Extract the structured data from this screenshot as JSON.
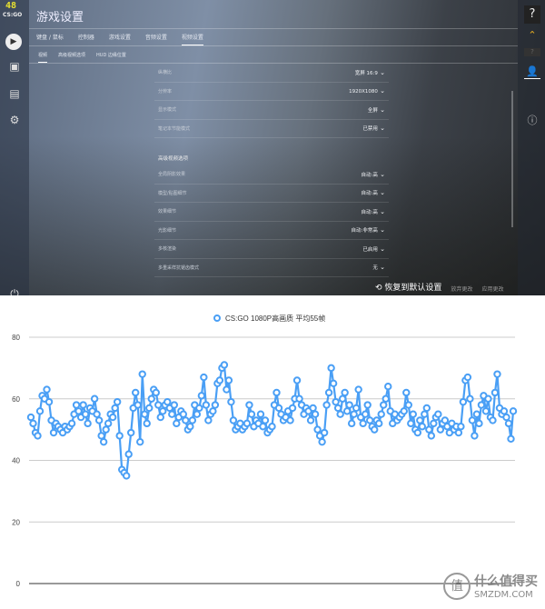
{
  "hud": {
    "fps": "48",
    "logo": "CS:GO"
  },
  "header": {
    "title": "游戏设置"
  },
  "tabs": [
    {
      "label": "键盘 / 鼠标"
    },
    {
      "label": "控制器"
    },
    {
      "label": "游戏设置"
    },
    {
      "label": "音频设置"
    },
    {
      "label": "视频设置"
    }
  ],
  "subtabs": [
    {
      "label": "视频"
    },
    {
      "label": "高级视频选项"
    },
    {
      "label": "HUD 边缘位置"
    }
  ],
  "settings": [
    {
      "label": "纵横比",
      "value": "宽屏 16:9"
    },
    {
      "label": "分辨率",
      "value": "1920X1080"
    },
    {
      "label": "显示模式",
      "value": "全屏"
    },
    {
      "label": "笔记本节能模式",
      "value": "已禁用"
    }
  ],
  "advanced": {
    "title": "高级视频选项",
    "items": [
      {
        "label": "全局阴影效果",
        "value": "自动:高"
      },
      {
        "label": "模型/贴图细节",
        "value": "自动:高"
      },
      {
        "label": "效果细节",
        "value": "自动:高"
      },
      {
        "label": "光影细节",
        "value": "自动:非常高"
      },
      {
        "label": "多核渲染",
        "value": "已启用"
      },
      {
        "label": "多重采样抗锯齿模式",
        "value": "无"
      }
    ]
  },
  "footer": {
    "reset": "恢复到默认设置",
    "discard": "放弃更改",
    "apply": "应用更改"
  },
  "watermark": {
    "brand": "什么值得买",
    "site": "SMZDM.COM",
    "mark": "值"
  },
  "chart_data": {
    "type": "line",
    "title": "",
    "legend": [
      "CS:GO 1080P高画质 平均55帧"
    ],
    "legend_position": "top",
    "ylim": [
      0,
      80
    ],
    "yticks": [
      0,
      20,
      40,
      60,
      80
    ],
    "grid": true,
    "color": "#4a9ff5",
    "series": [
      {
        "name": "CS:GO 1080P高画质 平均55帧",
        "values": [
          54,
          52,
          49,
          48,
          56,
          61,
          60,
          63,
          59,
          53,
          49,
          52,
          51,
          50,
          49,
          51,
          50,
          51,
          52,
          55,
          58,
          56,
          54,
          58,
          55,
          52,
          57,
          56,
          60,
          55,
          53,
          48,
          46,
          50,
          52,
          55,
          54,
          57,
          59,
          48,
          37,
          36,
          35,
          42,
          49,
          57,
          62,
          58,
          46,
          68,
          55,
          52,
          57,
          60,
          63,
          62,
          58,
          54,
          56,
          58,
          59,
          57,
          55,
          58,
          52,
          54,
          56,
          55,
          53,
          50,
          51,
          53,
          58,
          55,
          57,
          61,
          67,
          58,
          53,
          55,
          56,
          58,
          65,
          66,
          70,
          71,
          63,
          66,
          59,
          53,
          50,
          51,
          52,
          50,
          51,
          52,
          58,
          55,
          51,
          53,
          52,
          55,
          51,
          53,
          49,
          50,
          51,
          58,
          62,
          57,
          55,
          53,
          54,
          56,
          53,
          57,
          60,
          66,
          60,
          58,
          55,
          57,
          56,
          53,
          57,
          55,
          50,
          48,
          46,
          49,
          58,
          62,
          70,
          65,
          59,
          57,
          55,
          60,
          62,
          56,
          58,
          52,
          55,
          57,
          63,
          54,
          52,
          55,
          58,
          53,
          51,
          50,
          53,
          52,
          55,
          58,
          60,
          64,
          56,
          52,
          55,
          53,
          54,
          55,
          56,
          62,
          58,
          52,
          55,
          50,
          49,
          53,
          51,
          55,
          57,
          50,
          48,
          52,
          54,
          55,
          50,
          52,
          53,
          51,
          49,
          52,
          50,
          51,
          49,
          51,
          59,
          66,
          67,
          60,
          53,
          48,
          55,
          52,
          58,
          61,
          56,
          60,
          54,
          53,
          62,
          68,
          57,
          55,
          56,
          54,
          52,
          47,
          56
        ]
      }
    ]
  }
}
